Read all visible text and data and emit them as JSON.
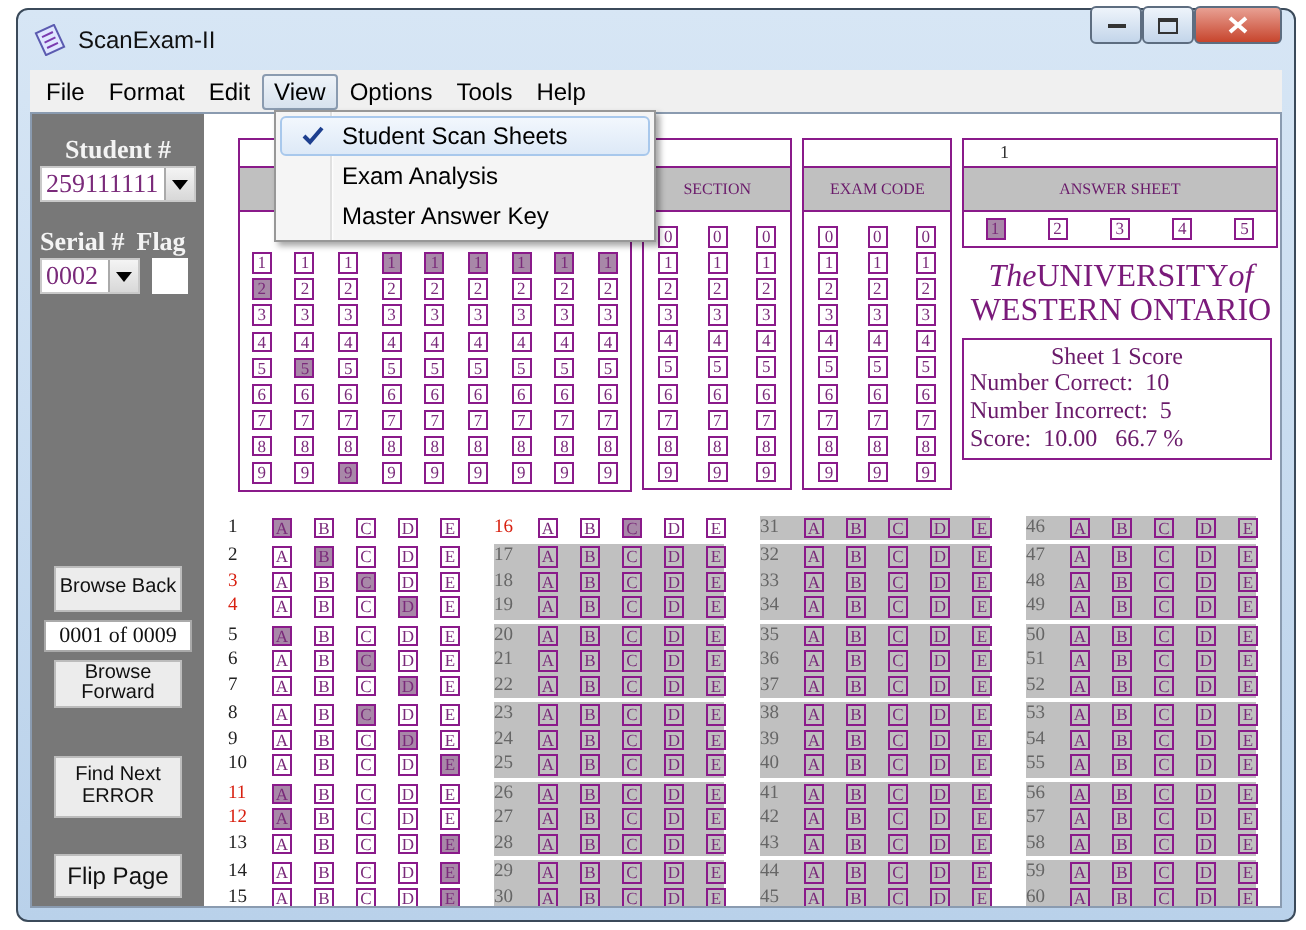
{
  "window": {
    "title": "ScanExam-II"
  },
  "menu": [
    {
      "label": "File",
      "selected": false
    },
    {
      "label": "Format",
      "selected": false
    },
    {
      "label": "Edit",
      "selected": false
    },
    {
      "label": "View",
      "selected": true
    },
    {
      "label": "Options",
      "selected": false
    },
    {
      "label": "Tools",
      "selected": false
    },
    {
      "label": "Help",
      "selected": false
    }
  ],
  "view_menu": [
    {
      "label": "Student Scan Sheets",
      "checked": true,
      "selected": true
    },
    {
      "label": "Exam Analysis",
      "checked": false,
      "selected": false
    },
    {
      "label": "Master Answer Key",
      "checked": false,
      "selected": false
    }
  ],
  "sidebar": {
    "student_label": "Student #",
    "student_value": "259111111",
    "serial_label": "Serial #",
    "flag_label": "Flag",
    "serial_value": "0002",
    "browse_back": "Browse Back",
    "position": "0001 of 0009",
    "browse_forward": "Browse Forward",
    "find_next": "Find Next ERROR",
    "flip_page": "Flip Page"
  },
  "student_number": {
    "columns": [
      {
        "digits": [
          "1",
          "2",
          "3",
          "4",
          "5",
          "6",
          "7",
          "8",
          "9"
        ],
        "filled": [
          false,
          true,
          false,
          false,
          false,
          false,
          false,
          false,
          false
        ]
      },
      {
        "digits": [
          "1",
          "2",
          "3",
          "4",
          "5",
          "6",
          "7",
          "8",
          "9"
        ],
        "filled": [
          false,
          false,
          false,
          false,
          true,
          false,
          false,
          false,
          false
        ]
      },
      {
        "digits": [
          "1",
          "2",
          "3",
          "4",
          "5",
          "6",
          "7",
          "8",
          "9"
        ],
        "filled": [
          false,
          false,
          false,
          false,
          false,
          false,
          false,
          false,
          true
        ]
      },
      {
        "digits": [
          "1",
          "2",
          "3",
          "4",
          "5",
          "6",
          "7",
          "8",
          "9"
        ],
        "filled": [
          true,
          false,
          false,
          false,
          false,
          false,
          false,
          false,
          false
        ]
      },
      {
        "digits": [
          "1",
          "2",
          "3",
          "4",
          "5",
          "6",
          "7",
          "8",
          "9"
        ],
        "filled": [
          true,
          false,
          false,
          false,
          false,
          false,
          false,
          false,
          false
        ]
      },
      {
        "digits": [
          "1",
          "2",
          "3",
          "4",
          "5",
          "6",
          "7",
          "8",
          "9"
        ],
        "filled": [
          true,
          false,
          false,
          false,
          false,
          false,
          false,
          false,
          false
        ]
      },
      {
        "digits": [
          "1",
          "2",
          "3",
          "4",
          "5",
          "6",
          "7",
          "8",
          "9"
        ],
        "filled": [
          true,
          false,
          false,
          false,
          false,
          false,
          false,
          false,
          false
        ]
      },
      {
        "digits": [
          "1",
          "2",
          "3",
          "4",
          "5",
          "6",
          "7",
          "8",
          "9"
        ],
        "filled": [
          true,
          false,
          false,
          false,
          false,
          false,
          false,
          false,
          false
        ]
      },
      {
        "digits": [
          "1",
          "2",
          "3",
          "4",
          "5",
          "6",
          "7",
          "8",
          "9"
        ],
        "filled": [
          true,
          false,
          false,
          false,
          false,
          false,
          false,
          false,
          false
        ]
      }
    ]
  },
  "section": {
    "heading": "SECTION",
    "columns": [
      {
        "digits": [
          "0",
          "1",
          "2",
          "3",
          "4",
          "5",
          "6",
          "7",
          "8",
          "9"
        ]
      },
      {
        "digits": [
          "0",
          "1",
          "2",
          "3",
          "4",
          "5",
          "6",
          "7",
          "8",
          "9"
        ]
      },
      {
        "digits": [
          "0",
          "1",
          "2",
          "3",
          "4",
          "5",
          "6",
          "7",
          "8",
          "9"
        ]
      }
    ]
  },
  "exam_code": {
    "heading": "EXAM CODE",
    "columns": [
      {
        "digits": [
          "0",
          "1",
          "2",
          "3",
          "4",
          "5",
          "6",
          "7",
          "8",
          "9"
        ]
      },
      {
        "digits": [
          "0",
          "1",
          "2",
          "3",
          "4",
          "5",
          "6",
          "7",
          "8",
          "9"
        ]
      },
      {
        "digits": [
          "0",
          "1",
          "2",
          "3",
          "4",
          "5",
          "6",
          "7",
          "8",
          "9"
        ]
      }
    ]
  },
  "answer_sheet": {
    "number": "1",
    "heading": "ANSWER SHEET",
    "sheets": [
      {
        "label": "1",
        "selected": true
      },
      {
        "label": "2",
        "selected": false
      },
      {
        "label": "3",
        "selected": false
      },
      {
        "label": "4",
        "selected": false
      },
      {
        "label": "5",
        "selected": false
      }
    ]
  },
  "logo": {
    "line_1": [
      "The",
      "UNIVERSITY",
      "of"
    ],
    "line_2": "WESTERN ONTARIO"
  },
  "score": {
    "title": "Sheet 1 Score",
    "lines": [
      "Number Correct:  10",
      "Number Incorrect:  5",
      "Score:  10.00   66.7 %"
    ]
  },
  "question_columns": [
    [
      {
        "n": "1",
        "options": [
          "A",
          "B",
          "C",
          "D",
          "E"
        ],
        "filled": [
          true,
          false,
          false,
          false,
          false
        ],
        "wrong": false,
        "active": true
      },
      {
        "n": "2",
        "options": [
          "A",
          "B",
          "C",
          "D",
          "E"
        ],
        "filled": [
          false,
          true,
          false,
          false,
          false
        ],
        "wrong": false,
        "active": true
      },
      {
        "n": "3",
        "options": [
          "A",
          "B",
          "C",
          "D",
          "E"
        ],
        "filled": [
          false,
          false,
          true,
          false,
          false
        ],
        "wrong": true,
        "active": true
      },
      {
        "n": "4",
        "options": [
          "A",
          "B",
          "C",
          "D",
          "E"
        ],
        "filled": [
          false,
          false,
          false,
          true,
          false
        ],
        "wrong": true,
        "active": true
      },
      {
        "n": "5",
        "options": [
          "A",
          "B",
          "C",
          "D",
          "E"
        ],
        "filled": [
          true,
          false,
          false,
          false,
          false
        ],
        "wrong": false,
        "active": true
      },
      {
        "n": "6",
        "options": [
          "A",
          "B",
          "C",
          "D",
          "E"
        ],
        "filled": [
          false,
          false,
          true,
          false,
          false
        ],
        "wrong": false,
        "active": true
      },
      {
        "n": "7",
        "options": [
          "A",
          "B",
          "C",
          "D",
          "E"
        ],
        "filled": [
          false,
          false,
          false,
          true,
          false
        ],
        "wrong": false,
        "active": true
      },
      {
        "n": "8",
        "options": [
          "A",
          "B",
          "C",
          "D",
          "E"
        ],
        "filled": [
          false,
          false,
          true,
          false,
          false
        ],
        "wrong": false,
        "active": true
      },
      {
        "n": "9",
        "options": [
          "A",
          "B",
          "C",
          "D",
          "E"
        ],
        "filled": [
          false,
          false,
          false,
          true,
          false
        ],
        "wrong": false,
        "active": true
      },
      {
        "n": "10",
        "options": [
          "A",
          "B",
          "C",
          "D",
          "E"
        ],
        "filled": [
          false,
          false,
          false,
          false,
          true
        ],
        "wrong": false,
        "active": true
      },
      {
        "n": "11",
        "options": [
          "A",
          "B",
          "C",
          "D",
          "E"
        ],
        "filled": [
          true,
          false,
          false,
          false,
          false
        ],
        "wrong": true,
        "active": true
      },
      {
        "n": "12",
        "options": [
          "A",
          "B",
          "C",
          "D",
          "E"
        ],
        "filled": [
          true,
          false,
          false,
          false,
          false
        ],
        "wrong": true,
        "active": true
      },
      {
        "n": "13",
        "options": [
          "A",
          "B",
          "C",
          "D",
          "E"
        ],
        "filled": [
          false,
          false,
          false,
          false,
          true
        ],
        "wrong": false,
        "active": true
      },
      {
        "n": "14",
        "options": [
          "A",
          "B",
          "C",
          "D",
          "E"
        ],
        "filled": [
          false,
          false,
          false,
          false,
          true
        ],
        "wrong": false,
        "active": true
      },
      {
        "n": "15",
        "options": [
          "A",
          "B",
          "C",
          "D",
          "E"
        ],
        "filled": [
          false,
          false,
          false,
          false,
          true
        ],
        "wrong": false,
        "active": true
      }
    ],
    [
      {
        "n": "16",
        "options": [
          "A",
          "B",
          "C",
          "D",
          "E"
        ],
        "filled": [
          false,
          false,
          true,
          false,
          false
        ],
        "wrong": true,
        "active": true
      },
      {
        "n": "17",
        "options": [
          "A",
          "B",
          "C",
          "D",
          "E"
        ],
        "wrong": false,
        "active": false
      },
      {
        "n": "18",
        "options": [
          "A",
          "B",
          "C",
          "D",
          "E"
        ],
        "wrong": false,
        "active": false
      },
      {
        "n": "19",
        "options": [
          "A",
          "B",
          "C",
          "D",
          "E"
        ],
        "wrong": false,
        "active": false
      },
      {
        "n": "20",
        "options": [
          "A",
          "B",
          "C",
          "D",
          "E"
        ],
        "wrong": false,
        "active": false
      },
      {
        "n": "21",
        "options": [
          "A",
          "B",
          "C",
          "D",
          "E"
        ],
        "wrong": false,
        "active": false
      },
      {
        "n": "22",
        "options": [
          "A",
          "B",
          "C",
          "D",
          "E"
        ],
        "wrong": false,
        "active": false
      },
      {
        "n": "23",
        "options": [
          "A",
          "B",
          "C",
          "D",
          "E"
        ],
        "wrong": false,
        "active": false
      },
      {
        "n": "24",
        "options": [
          "A",
          "B",
          "C",
          "D",
          "E"
        ],
        "wrong": false,
        "active": false
      },
      {
        "n": "25",
        "options": [
          "A",
          "B",
          "C",
          "D",
          "E"
        ],
        "wrong": false,
        "active": false
      },
      {
        "n": "26",
        "options": [
          "A",
          "B",
          "C",
          "D",
          "E"
        ],
        "wrong": false,
        "active": false
      },
      {
        "n": "27",
        "options": [
          "A",
          "B",
          "C",
          "D",
          "E"
        ],
        "wrong": false,
        "active": false
      },
      {
        "n": "28",
        "options": [
          "A",
          "B",
          "C",
          "D",
          "E"
        ],
        "wrong": false,
        "active": false
      },
      {
        "n": "29",
        "options": [
          "A",
          "B",
          "C",
          "D",
          "E"
        ],
        "wrong": false,
        "active": false
      },
      {
        "n": "30",
        "options": [
          "A",
          "B",
          "C",
          "D",
          "E"
        ],
        "wrong": false,
        "active": false
      }
    ],
    [
      {
        "n": "31",
        "options": [
          "A",
          "B",
          "C",
          "D",
          "E"
        ],
        "wrong": false,
        "active": false
      },
      {
        "n": "32",
        "options": [
          "A",
          "B",
          "C",
          "D",
          "E"
        ],
        "wrong": false,
        "active": false
      },
      {
        "n": "33",
        "options": [
          "A",
          "B",
          "C",
          "D",
          "E"
        ],
        "wrong": false,
        "active": false
      },
      {
        "n": "34",
        "options": [
          "A",
          "B",
          "C",
          "D",
          "E"
        ],
        "wrong": false,
        "active": false
      },
      {
        "n": "35",
        "options": [
          "A",
          "B",
          "C",
          "D",
          "E"
        ],
        "wrong": false,
        "active": false
      },
      {
        "n": "36",
        "options": [
          "A",
          "B",
          "C",
          "D",
          "E"
        ],
        "wrong": false,
        "active": false
      },
      {
        "n": "37",
        "options": [
          "A",
          "B",
          "C",
          "D",
          "E"
        ],
        "wrong": false,
        "active": false
      },
      {
        "n": "38",
        "options": [
          "A",
          "B",
          "C",
          "D",
          "E"
        ],
        "wrong": false,
        "active": false
      },
      {
        "n": "39",
        "options": [
          "A",
          "B",
          "C",
          "D",
          "E"
        ],
        "wrong": false,
        "active": false
      },
      {
        "n": "40",
        "options": [
          "A",
          "B",
          "C",
          "D",
          "E"
        ],
        "wrong": false,
        "active": false
      },
      {
        "n": "41",
        "options": [
          "A",
          "B",
          "C",
          "D",
          "E"
        ],
        "wrong": false,
        "active": false
      },
      {
        "n": "42",
        "options": [
          "A",
          "B",
          "C",
          "D",
          "E"
        ],
        "wrong": false,
        "active": false
      },
      {
        "n": "43",
        "options": [
          "A",
          "B",
          "C",
          "D",
          "E"
        ],
        "wrong": false,
        "active": false
      },
      {
        "n": "44",
        "options": [
          "A",
          "B",
          "C",
          "D",
          "E"
        ],
        "wrong": false,
        "active": false
      },
      {
        "n": "45",
        "options": [
          "A",
          "B",
          "C",
          "D",
          "E"
        ],
        "wrong": false,
        "active": false
      }
    ],
    [
      {
        "n": "46",
        "options": [
          "A",
          "B",
          "C",
          "D",
          "E"
        ],
        "wrong": false,
        "active": false
      },
      {
        "n": "47",
        "options": [
          "A",
          "B",
          "C",
          "D",
          "E"
        ],
        "wrong": false,
        "active": false
      },
      {
        "n": "48",
        "options": [
          "A",
          "B",
          "C",
          "D",
          "E"
        ],
        "wrong": false,
        "active": false
      },
      {
        "n": "49",
        "options": [
          "A",
          "B",
          "C",
          "D",
          "E"
        ],
        "wrong": false,
        "active": false
      },
      {
        "n": "50",
        "options": [
          "A",
          "B",
          "C",
          "D",
          "E"
        ],
        "wrong": false,
        "active": false
      },
      {
        "n": "51",
        "options": [
          "A",
          "B",
          "C",
          "D",
          "E"
        ],
        "wrong": false,
        "active": false
      },
      {
        "n": "52",
        "options": [
          "A",
          "B",
          "C",
          "D",
          "E"
        ],
        "wrong": false,
        "active": false
      },
      {
        "n": "53",
        "options": [
          "A",
          "B",
          "C",
          "D",
          "E"
        ],
        "wrong": false,
        "active": false
      },
      {
        "n": "54",
        "options": [
          "A",
          "B",
          "C",
          "D",
          "E"
        ],
        "wrong": false,
        "active": false
      },
      {
        "n": "55",
        "options": [
          "A",
          "B",
          "C",
          "D",
          "E"
        ],
        "wrong": false,
        "active": false
      },
      {
        "n": "56",
        "options": [
          "A",
          "B",
          "C",
          "D",
          "E"
        ],
        "wrong": false,
        "active": false
      },
      {
        "n": "57",
        "options": [
          "A",
          "B",
          "C",
          "D",
          "E"
        ],
        "wrong": false,
        "active": false
      },
      {
        "n": "58",
        "options": [
          "A",
          "B",
          "C",
          "D",
          "E"
        ],
        "wrong": false,
        "active": false
      },
      {
        "n": "59",
        "options": [
          "A",
          "B",
          "C",
          "D",
          "E"
        ],
        "wrong": false,
        "active": false
      },
      {
        "n": "60",
        "options": [
          "A",
          "B",
          "C",
          "D",
          "E"
        ],
        "wrong": false,
        "active": false
      }
    ]
  ]
}
